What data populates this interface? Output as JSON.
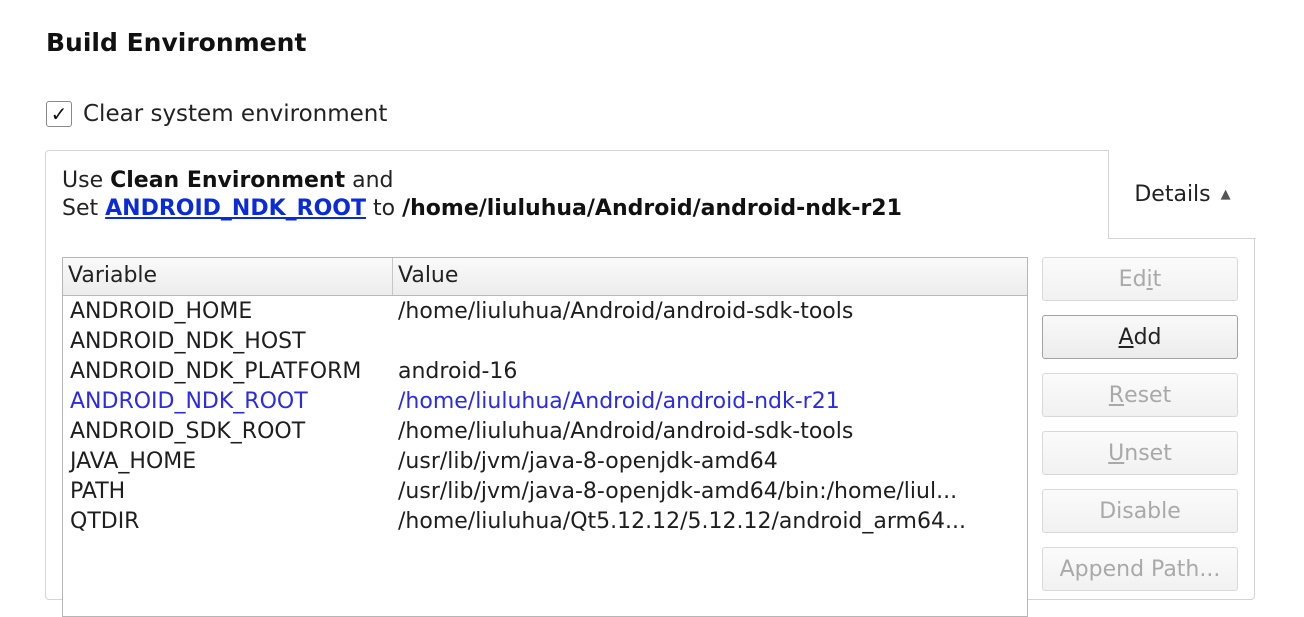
{
  "section_title": "Build Environment",
  "clear_env": {
    "checked": true,
    "check_glyph": "✓",
    "label": "Clear system environment"
  },
  "summary": {
    "line1_prefix": "Use ",
    "line1_bold": "Clean Environment",
    "line1_suffix": " and",
    "line2_prefix": "Set ",
    "line2_link": "ANDROID_NDK_ROOT",
    "line2_mid": " to ",
    "line2_bold": "/home/liuluhua/Android/android-ndk-r21",
    "link_color": "#0a2bd8"
  },
  "details": {
    "label": "Details",
    "icon": "triangle-up-icon",
    "glyph": "▲"
  },
  "table": {
    "headers": {
      "variable": "Variable",
      "value": "Value"
    },
    "rows": [
      {
        "variable": "ANDROID_HOME",
        "value": "/home/liuluhua/Android/android-sdk-tools",
        "changed": false
      },
      {
        "variable": "ANDROID_NDK_HOST",
        "value": "",
        "changed": false
      },
      {
        "variable": "ANDROID_NDK_PLATFORM",
        "value": "android-16",
        "changed": false
      },
      {
        "variable": "ANDROID_NDK_ROOT",
        "value": "/home/liuluhua/Android/android-ndk-r21",
        "changed": true
      },
      {
        "variable": "ANDROID_SDK_ROOT",
        "value": "/home/liuluhua/Android/android-sdk-tools",
        "changed": false
      },
      {
        "variable": "JAVA_HOME",
        "value": "/usr/lib/jvm/java-8-openjdk-amd64",
        "changed": false
      },
      {
        "variable": "PATH",
        "value": "/usr/lib/jvm/java-8-openjdk-amd64/bin:/home/liul...",
        "changed": false
      },
      {
        "variable": "QTDIR",
        "value": "/home/liuluhua/Qt5.12.12/5.12.12/android_arm64...",
        "changed": false
      }
    ],
    "changed_color": "#2a2ae8"
  },
  "buttons": [
    {
      "name": "edit-button",
      "pre": "Ed",
      "mnemonic": "i",
      "post": "t",
      "enabled": false
    },
    {
      "name": "add-button",
      "pre": "",
      "mnemonic": "A",
      "post": "dd",
      "enabled": true
    },
    {
      "name": "reset-button",
      "pre": "",
      "mnemonic": "R",
      "post": "eset",
      "enabled": false
    },
    {
      "name": "unset-button",
      "pre": "",
      "mnemonic": "U",
      "post": "nset",
      "enabled": false
    },
    {
      "name": "disable-button",
      "pre": "Disable",
      "mnemonic": "",
      "post": "",
      "enabled": false
    },
    {
      "name": "append-path-button",
      "pre": "Append Path...",
      "mnemonic": "",
      "post": "",
      "enabled": false
    }
  ]
}
